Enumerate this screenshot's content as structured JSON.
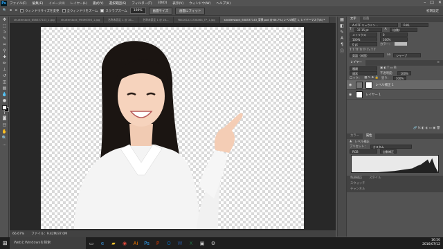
{
  "menubar": {
    "logo": "Ps",
    "items": [
      "ファイル(F)",
      "編集(E)",
      "イメージ(I)",
      "レイヤー(L)",
      "書式(Y)",
      "選択範囲(S)",
      "フィルター(T)",
      "3D(D)",
      "表示(V)",
      "ウィンドウ(W)",
      "ヘルプ(H)"
    ],
    "controls": [
      "–",
      "□",
      "✕"
    ]
  },
  "options": {
    "refine_label": "ウィンドウサイズを変更",
    "all_windows_label": "全ウィンドウをズーム",
    "scrubby_label": "スクラブズーム",
    "zoom_value": "100%",
    "fit_screen": "画面サイズ",
    "fill_screen": "画面にフィット",
    "workspace": "初期設定"
  },
  "tabs": [
    {
      "label": "shutterstock_658537143_1.jpg"
    },
    {
      "label": "shutterstock_99496356_1.jpg"
    },
    {
      "label": "名称未設定 1 @ 16..."
    },
    {
      "label": "名称未設定 1 @ 16..."
    },
    {
      "label": "FB4161221338464_TP_1.jpg"
    },
    {
      "label": "shutterstock_658537143_背景.psd @ 66.7% (レベル補正 1, レイヤーマスク/8) *"
    }
  ],
  "status": {
    "zoom": "66.67%",
    "doc": "ファイル：9.42M/37.0M"
  },
  "panels": {
    "top_tabs": [
      "文字",
      "段落"
    ],
    "font_name": "A-OTF リュウミン...",
    "font_style": "R-KL",
    "font_size": "37.15 pt",
    "leading": "(自動)",
    "tracking": "0",
    "kerning": "メトリクス",
    "scale_v": "100%",
    "scale_h": "100%",
    "baseline": "0 pt",
    "color_label": "カラー：",
    "lang": "英語（米国）",
    "aa": "シャープ",
    "aa_short": "aa",
    "layers_tab": "レイヤー",
    "layers_menu": "≡",
    "kind_label": "種類",
    "blend_mode": "通常",
    "opacity_label": "不透明度：",
    "opacity": "100%",
    "lock_label": "ロック：",
    "fill_label": "塗り：",
    "fill": "100%",
    "layers": [
      {
        "name": "レベル補正 1",
        "selected": true
      },
      {
        "name": "レイヤー 1",
        "selected": false
      }
    ],
    "bottom_tabs": [
      "カラー",
      "属性"
    ],
    "props_title": "レベル補正",
    "preset_label": "プリセット：",
    "preset_value": "カスタム",
    "channel": "RGB",
    "auto_label": "自動補正",
    "lower_tabs": [
      "色調補正",
      "スタイル"
    ],
    "swatches": "スウォッチ",
    "channels": "チャンネル"
  },
  "taskbar": {
    "search_placeholder": "WebとWindowsを検索",
    "time": "16:50",
    "date": "2016/07/12"
  }
}
